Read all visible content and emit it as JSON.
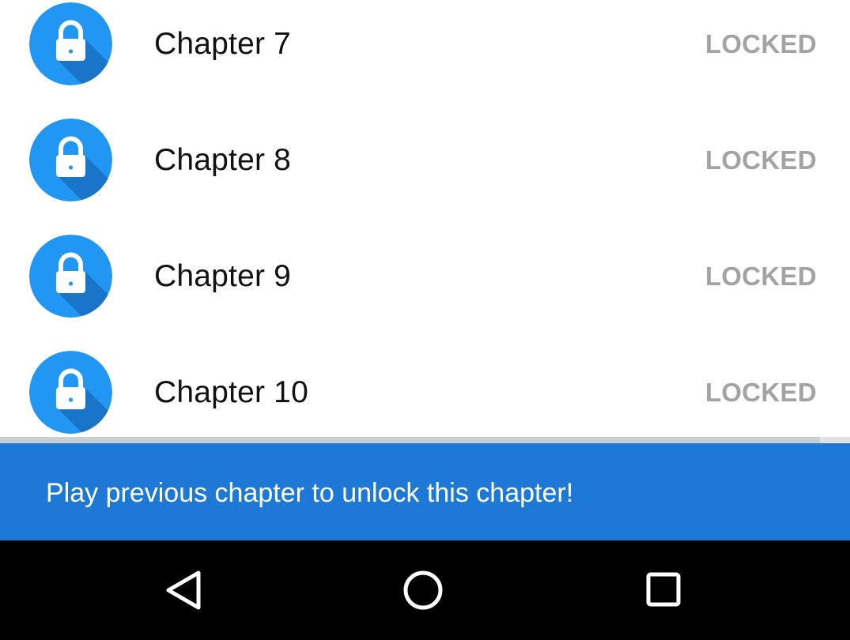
{
  "chapters": [
    {
      "title": "Chapter 7",
      "status": "LOCKED"
    },
    {
      "title": "Chapter 8",
      "status": "LOCKED"
    },
    {
      "title": "Chapter 9",
      "status": "LOCKED"
    },
    {
      "title": "Chapter 10",
      "status": "LOCKED"
    }
  ],
  "snackbar": {
    "message": "Play previous chapter to unlock this chapter!"
  },
  "icons": {
    "chapter": "lock-icon",
    "nav_back": "back-triangle-icon",
    "nav_home": "home-circle-icon",
    "nav_recent": "recent-apps-square-icon"
  },
  "colors": {
    "badge": "#2196f3",
    "badge_shadow": "#1a75c8",
    "status_text": "#a3a3a3",
    "snackbar": "#1e78d6",
    "navbar": "#000000"
  }
}
